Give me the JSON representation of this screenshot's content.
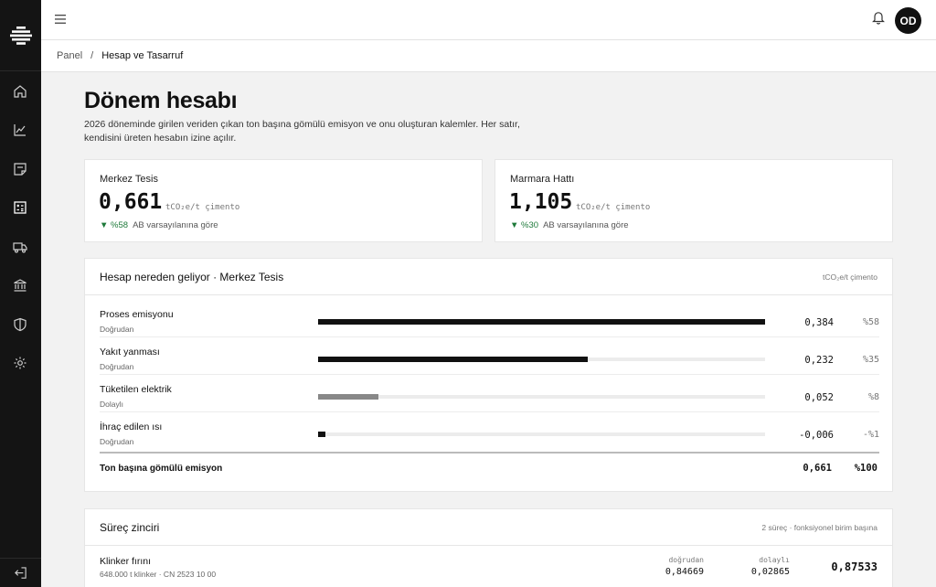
{
  "user": {
    "initials": "OD"
  },
  "breadcrumb": {
    "parent": "Panel",
    "separator": "/",
    "current": "Hesap ve Tasarruf"
  },
  "page": {
    "title": "Dönem hesabı",
    "description": "2026 döneminde girilen veriden çıkan ton başına gömülü emisyon ve onu oluşturan kalemler. Her satır, kendisini üreten hesabın izine açılır."
  },
  "kpis": [
    {
      "name": "Merkez Tesis",
      "value": "0,661",
      "unit": "tCO₂e/t çimento",
      "delta": "▼ %58",
      "delta_note": "AB varsayılanına göre"
    },
    {
      "name": "Marmara Hattı",
      "value": "1,105",
      "unit": "tCO₂e/t çimento",
      "delta": "▼ %30",
      "delta_note": "AB varsayılanına göre"
    }
  ],
  "breakdown": {
    "title": "Hesap nereden geliyor · Merkez Tesis",
    "unit_note": "tCO₂e/t çimento",
    "rows": [
      {
        "name": "Proses emisyonu",
        "type": "Doğrudan",
        "value": "0,384",
        "pct": "%58",
        "share": 1.0,
        "color": "#111111"
      },
      {
        "name": "Yakıt yanması",
        "type": "Doğrudan",
        "value": "0,232",
        "pct": "%35",
        "share": 0.604,
        "color": "#111111"
      },
      {
        "name": "Tüketilen elektrik",
        "type": "Dolaylı",
        "value": "0,052",
        "pct": "%8",
        "share": 0.135,
        "color": "#888888"
      },
      {
        "name": "İhraç edilen ısı",
        "type": "Doğrudan",
        "value": "-0,006",
        "pct": "-%1",
        "share": 0.016,
        "color": "#111111"
      }
    ],
    "total": {
      "label": "Ton başına gömülü emisyon",
      "value": "0,661",
      "pct": "%100"
    }
  },
  "process_chain": {
    "title": "Süreç zinciri",
    "note": "2 süreç · fonksiyonel birim başına",
    "columns": {
      "direct": "doğrudan",
      "indirect": "dolaylı"
    },
    "items": [
      {
        "name": "Klinker fırını",
        "sub": "648.000 t klinker · CN 2523 10 00",
        "direct": "0,84669",
        "indirect": "0,02865",
        "total": "0,87533"
      }
    ]
  },
  "colors": {
    "sidebar": "#141414",
    "positive": "#1e7a3a",
    "bar": "#111111",
    "bar_secondary": "#888888"
  }
}
